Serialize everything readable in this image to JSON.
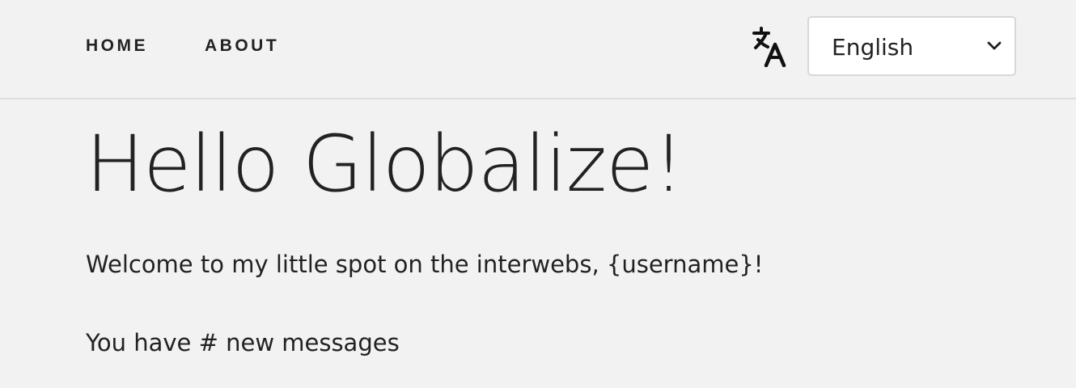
{
  "header": {
    "nav": [
      {
        "label": "HOME"
      },
      {
        "label": "ABOUT"
      }
    ],
    "language_icon": "translate-icon",
    "language_select": {
      "selected": "English"
    }
  },
  "main": {
    "title": "Hello Globalize!",
    "welcome": "Welcome to my little spot on the interwebs, {username}!",
    "messages": "You have # new messages"
  },
  "colors": {
    "background": "#f2f2f2",
    "text": "#222222",
    "border": "#dedede",
    "select_bg": "#ffffff"
  }
}
